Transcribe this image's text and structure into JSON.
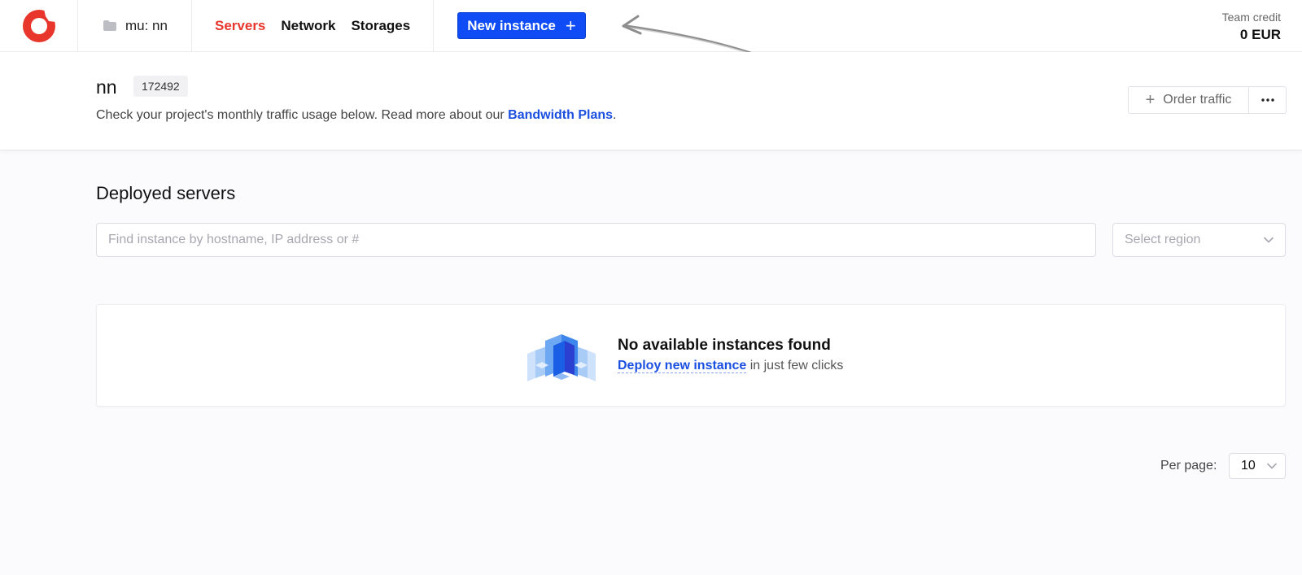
{
  "topbar": {
    "project_label": "mu: nn",
    "nav": [
      {
        "label": "Servers",
        "active": true
      },
      {
        "label": "Network",
        "active": false
      },
      {
        "label": "Storages",
        "active": false
      }
    ],
    "new_instance_label": "New instance",
    "credit_label": "Team credit",
    "credit_value": "0 EUR"
  },
  "project": {
    "name": "nn",
    "id": "172492",
    "description": "Check your project's monthly traffic usage below. Read more about our",
    "description_link": "Bandwidth Plans",
    "description_end": ".",
    "order_traffic_label": "Order traffic"
  },
  "servers": {
    "title": "Deployed servers",
    "search_placeholder": "Find instance by hostname, IP address or #",
    "region_placeholder": "Select region",
    "empty_title": "No available instances found",
    "empty_link": "Deploy new instance",
    "empty_suffix": " in just few clicks"
  },
  "pagination": {
    "per_page_label": "Per page:",
    "per_page_value": "10"
  },
  "colors": {
    "brand": "#e8362d",
    "accent": "#0f4cf5",
    "link": "#1a4fe0"
  },
  "icons": {
    "logo": "brand-logo-icon",
    "project": "folder-icon",
    "new_instance": "plus-icon",
    "order_traffic": "plus-icon",
    "more": "more-dots-icon",
    "dropdown": "chevron-down-icon",
    "empty": "instances-illustration-icon",
    "annotation": "arrow-annotation-icon"
  }
}
